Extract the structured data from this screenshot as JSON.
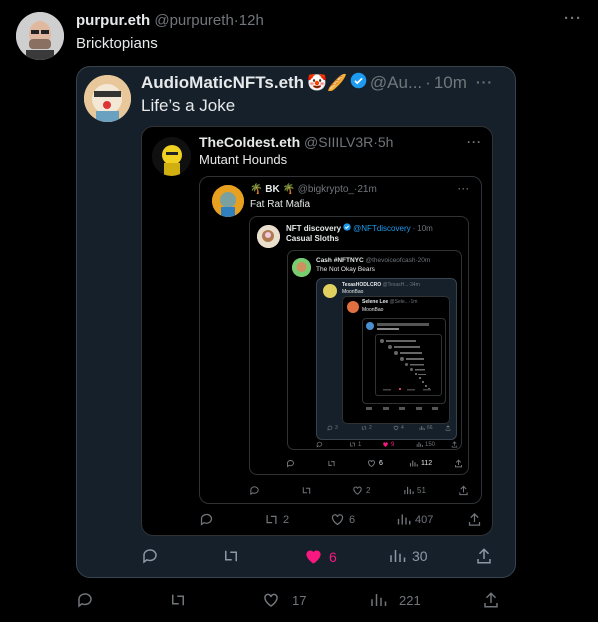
{
  "tweet": {
    "author_name": "purpur.eth",
    "author_handle": "@purpureth",
    "sep": "·",
    "time": "12h",
    "text": "Bricktopians",
    "actions": {
      "reply": "",
      "retweet": "",
      "like": "17",
      "views": "221"
    }
  },
  "quote1": {
    "author_name": "AudioMaticNFTs.eth",
    "emoji": "🤡🥖",
    "author_handle": "@Au...",
    "sep": "·",
    "time": "10m",
    "text": "Life’s a Joke",
    "actions": {
      "reply": "",
      "retweet": "",
      "like": "6",
      "views": "30"
    }
  },
  "quote2": {
    "author_name": "TheColdest.eth",
    "author_handle": "@SIIILV3R",
    "sep": "·",
    "time": "5h",
    "text": "Mutant Hounds",
    "actions": {
      "reply": "",
      "retweet": "2",
      "like": "6",
      "views": "407"
    }
  },
  "quote3": {
    "author_name": "🌴 BK 🌴",
    "author_handle": "@bigkrypto_",
    "sep": "·",
    "time": "21m",
    "text": "Fat Rat Mafia",
    "actions": {
      "reply": "",
      "retweet": "",
      "like": "2",
      "views": "51"
    }
  },
  "quote4": {
    "author_name": "NFT discovery",
    "author_handle": "@NFTdiscovery",
    "sep": "·",
    "time": "10m",
    "text": "Casual Sloths",
    "actions": {
      "reply": "",
      "retweet": "",
      "like": "6",
      "views": "112"
    }
  },
  "quote5": {
    "author_name": "Cash #NFTNYC",
    "author_handle": "@thevoiceofcash",
    "sep": "·",
    "time": "20m",
    "text": "The Not Okay Bears",
    "actions": {
      "reply": "",
      "retweet": "1",
      "like": "9",
      "views": "150"
    }
  },
  "quote6": {
    "author_name": "TexasHODLCRO",
    "author_handle": "@TexasH...",
    "sep": "·",
    "time": "34m",
    "text": "MoonBao",
    "actions": {
      "reply": "3",
      "retweet": "2",
      "like": "4",
      "views": "66"
    }
  },
  "quote7": {
    "author_name": "Selene Lee",
    "author_handle": "@Sele...",
    "sep": "·",
    "time": "1m",
    "text": "MoonBao"
  },
  "colors": {
    "bg": "#000000",
    "card": "#15202b",
    "border": "#2f3336",
    "muted": "#71767b",
    "like_active": "#f91880",
    "verified": "#1d9bf0"
  }
}
